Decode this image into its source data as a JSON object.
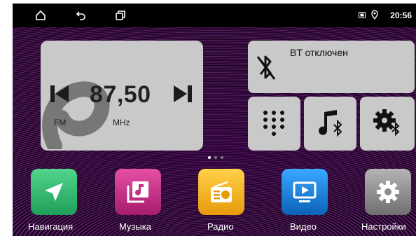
{
  "statusbar": {
    "nav": [
      {
        "icon": "home-icon"
      },
      {
        "icon": "back-icon"
      },
      {
        "icon": "recent-apps-icon"
      }
    ],
    "indicators": [
      "sim-icon",
      "location-icon"
    ],
    "time": "20:56"
  },
  "radio": {
    "frequency": "87,50",
    "band": "FM",
    "unit": "MHz",
    "icons": [
      "previous-station-icon",
      "next-station-icon"
    ]
  },
  "bluetooth": {
    "status": "BT отключен",
    "icon": "bluetooth-off-icon"
  },
  "shortcuts": [
    {
      "icon": "dialpad-icon"
    },
    {
      "icon": "bluetooth-music-icon"
    },
    {
      "icon": "bluetooth-settings-icon"
    }
  ],
  "pager": {
    "pages": 3,
    "active": 0
  },
  "dock": [
    {
      "label": "Навигация",
      "icon": "navigation-icon",
      "color": "#2fb86b"
    },
    {
      "label": "Музыка",
      "icon": "music-icon",
      "color": "#c42f86"
    },
    {
      "label": "Радио",
      "icon": "radio-icon",
      "color": "#f1b21c"
    },
    {
      "label": "Видео",
      "icon": "video-icon",
      "color": "#1a7fd6"
    },
    {
      "label": "Настройки",
      "icon": "settings-icon",
      "color": "#8d8d8d"
    }
  ],
  "colors": {
    "topbar": "#000000",
    "card": "#c9c9c9",
    "text_dark": "#222222"
  }
}
